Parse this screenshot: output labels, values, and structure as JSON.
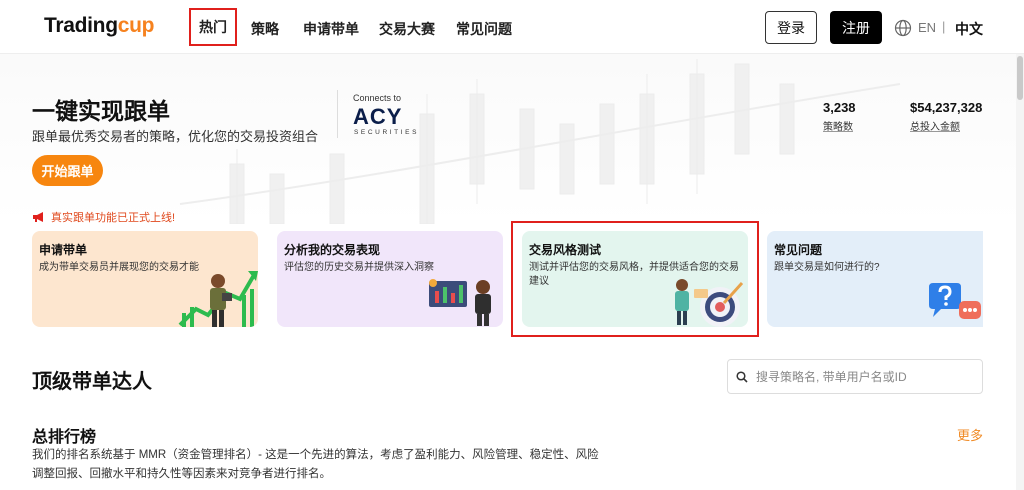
{
  "header": {
    "logo_main": "Trading",
    "logo_accent": "cup",
    "nav": [
      "热门",
      "策略",
      "申请带单",
      "交易大赛",
      "常见问题"
    ],
    "login_label": "登录",
    "register_label": "注册",
    "lang_en": "EN",
    "lang_sep": "|",
    "lang_zh": "中文"
  },
  "hero": {
    "title": "一键实现跟单",
    "subtitle": "跟单最优秀交易者的策略，优化您的交易投资组合",
    "connects_to": "Connects to",
    "partner_logo": "ACY",
    "partner_sub": "SECURITIES",
    "start_button": "开始跟单",
    "stats": [
      {
        "value": "3,238",
        "label": "策略数"
      },
      {
        "value": "$54,237,328",
        "label": "总投入金额"
      }
    ]
  },
  "notice": {
    "icon": "megaphone-icon",
    "text": "真实跟单功能已正式上线!"
  },
  "cards": [
    {
      "title": "申请带单",
      "desc": "成为带单交易员并展现您的交易才能",
      "bg": "#fde6cf"
    },
    {
      "title": "分析我的交易表现",
      "desc": "评估您的历史交易并提供深入洞察",
      "bg": "#f1e6fa"
    },
    {
      "title": "交易风格测试",
      "desc": "测试并评估您的交易风格，并提供适合您的交易建议",
      "bg": "#e3f5ee"
    },
    {
      "title": "常见问题",
      "desc": "跟单交易是如何进行的?",
      "bg": "#e3eef9"
    }
  ],
  "leaders": {
    "title": "顶级带单达人",
    "search_placeholder": "搜寻策略名, 带单用户名或ID"
  },
  "ranking": {
    "title": "总排行榜",
    "more": "更多",
    "desc": "我们的排名系统基于 MMR（资金管理排名）- 这是一个先进的算法，考虑了盈利能力、风险管理、稳定性、风险调整回报、回撤水平和持久性等因素来对竞争者进行排名。"
  },
  "colors": {
    "accent": "#f7860f",
    "highlight": "#e0201c",
    "brand_navy": "#0b1e4a"
  }
}
